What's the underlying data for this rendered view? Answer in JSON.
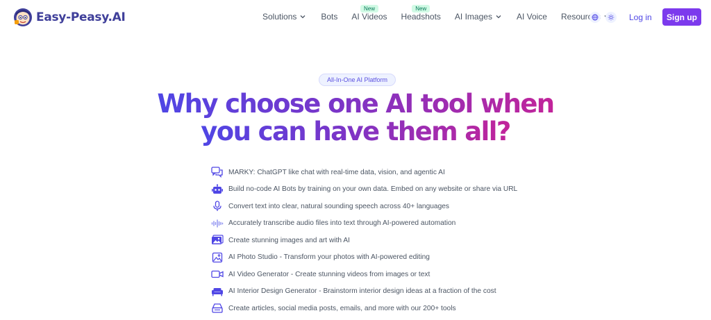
{
  "brand": {
    "name": "Easy-Peasy.AI"
  },
  "nav": {
    "items": [
      {
        "label": "Solutions",
        "dropdown": true
      },
      {
        "label": "Bots"
      },
      {
        "label": "AI Videos",
        "badge": "New"
      },
      {
        "label": "Headshots",
        "badge": "New"
      },
      {
        "label": "AI Images",
        "dropdown": true
      },
      {
        "label": "AI Voice"
      },
      {
        "label": "Resources",
        "dropdown": true
      }
    ],
    "login": "Log in",
    "signup": "Sign up"
  },
  "hero": {
    "pill": "All-In-One AI Platform",
    "headline_line1": "Why choose one AI tool when",
    "headline_line2": "you can have them all?"
  },
  "features": [
    {
      "icon": "chat-icon",
      "text": "MARKY: ChatGPT like chat with real-time data, vision, and agentic AI"
    },
    {
      "icon": "robot-icon",
      "text": "Build no-code AI Bots by training on your own data. Embed on any website or share via URL"
    },
    {
      "icon": "microphone-icon",
      "text": "Convert text into clear, natural sounding speech across 40+ languages"
    },
    {
      "icon": "waveform-icon",
      "text": "Accurately transcribe audio files into text through AI-powered automation"
    },
    {
      "icon": "images-icon",
      "text": "Create stunning images and art with AI"
    },
    {
      "icon": "photo-icon",
      "text": "AI Photo Studio - Transform your photos with AI-powered editing"
    },
    {
      "icon": "video-icon",
      "text": "AI Video Generator - Create stunning videos from images or text"
    },
    {
      "icon": "sofa-icon",
      "text": "AI Interior Design Generator - Brainstorm interior design ideas at a fraction of the cost"
    },
    {
      "icon": "layers-icon",
      "text": "Create articles, social media posts, emails, and more with our 200+ tools"
    }
  ],
  "colors": {
    "accent": "#4f46e5",
    "signup_bg": "#7c3aed",
    "gradient_start": "#4f46e5",
    "gradient_end": "#c2249a",
    "new_badge_bg": "#d1fae5"
  }
}
